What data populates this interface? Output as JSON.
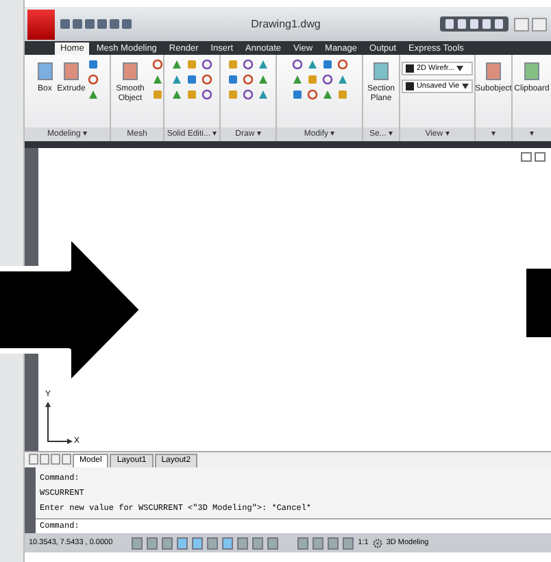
{
  "window": {
    "title": "Drawing1.dwg"
  },
  "ribbon_tabs": [
    {
      "label": "Home",
      "selected": true
    },
    {
      "label": "Mesh Modeling",
      "selected": false
    },
    {
      "label": "Render",
      "selected": false
    },
    {
      "label": "Insert",
      "selected": false
    },
    {
      "label": "Annotate",
      "selected": false
    },
    {
      "label": "View",
      "selected": false
    },
    {
      "label": "Manage",
      "selected": false
    },
    {
      "label": "Output",
      "selected": false
    },
    {
      "label": "Express Tools",
      "selected": false
    }
  ],
  "ribbon_panels": [
    {
      "title": "Modeling ▾",
      "kind": "tools",
      "tools": [
        "Box",
        "Extrude"
      ]
    },
    {
      "title": "Mesh",
      "kind": "tools",
      "tools": [
        "Smooth Object"
      ]
    },
    {
      "title": "Solid Editi... ▾",
      "kind": "icons"
    },
    {
      "title": "Draw ▾",
      "kind": "icons"
    },
    {
      "title": "Modify ▾",
      "kind": "icons"
    },
    {
      "title": "Se... ▾",
      "kind": "tools",
      "tools": [
        "Section Plane"
      ]
    },
    {
      "title": "View ▾",
      "kind": "dropdowns",
      "dropdowns": [
        "2D Wirefr...",
        "Unsaved Vie"
      ]
    },
    {
      "title": "▾",
      "kind": "tools",
      "tools": [
        "Subobject"
      ]
    },
    {
      "title": "▾",
      "kind": "tools",
      "tools": [
        "Clipboard"
      ]
    }
  ],
  "ucs": {
    "x_label": "X",
    "y_label": "Y"
  },
  "layout_tabs": [
    {
      "label": "Model",
      "selected": true
    },
    {
      "label": "Layout1",
      "selected": false
    },
    {
      "label": "Layout2",
      "selected": false
    }
  ],
  "command_history": [
    "Command:",
    "WSCURRENT",
    "Enter new value for WSCURRENT <\"3D Modeling\">: *Cancel*"
  ],
  "command_prompt": "Command:",
  "status_bar": {
    "coordinates": "10.3543, 7.5433 , 0.0000",
    "annotation_scale": "1:1",
    "workspace": "3D Modeling"
  }
}
